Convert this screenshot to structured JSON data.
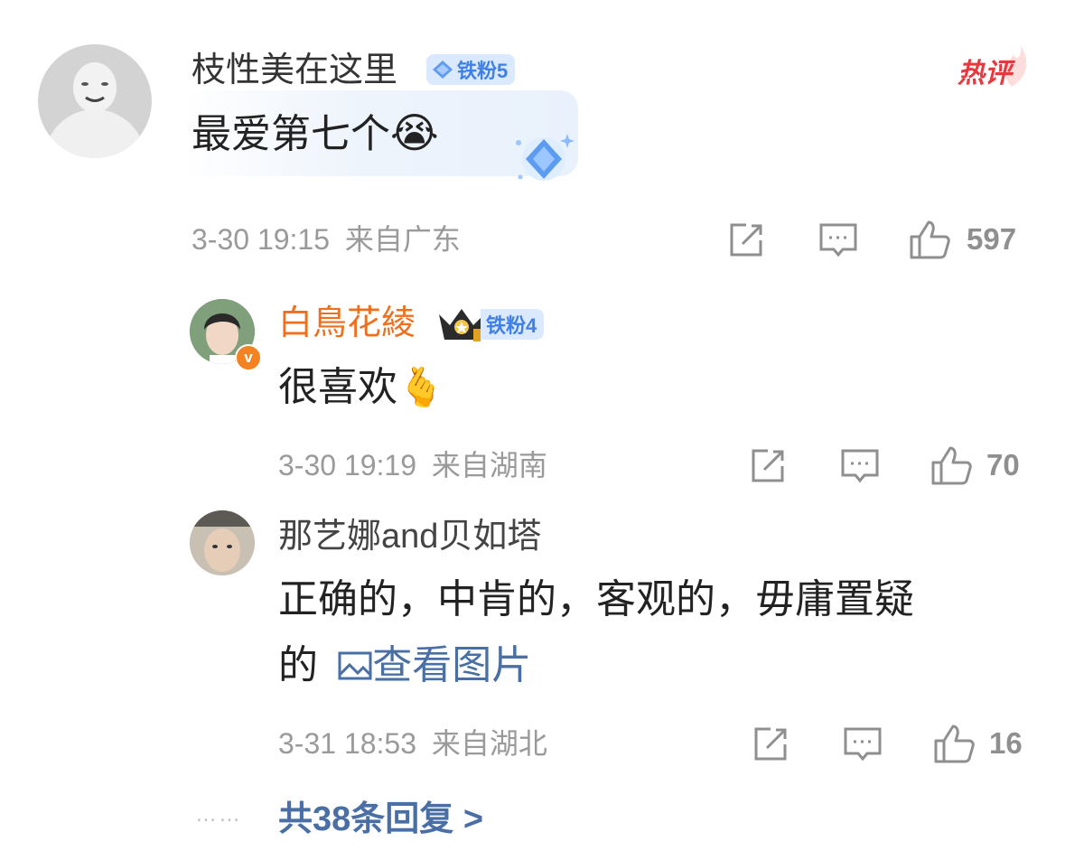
{
  "hot_label": "热评",
  "comment": {
    "user": "枝性美在这里",
    "badge": "铁粉5",
    "text": "最爱第七个",
    "emoji": "😭",
    "time": "3-30 19:15",
    "location": "来自广东",
    "likes": "597"
  },
  "replies": [
    {
      "user": "白鳥花綾",
      "badge": "铁粉4",
      "emoji": "🫰",
      "text": "很喜欢",
      "time": "3-30 19:19",
      "location": "来自湖南",
      "likes": "70",
      "name_color": "#f06f1f",
      "verified": true
    },
    {
      "user": "那艺娜and贝如塔",
      "text_line1": "正确的，中肯的，客观的，毋庸置疑",
      "text_line2": "的",
      "link_text": "查看图片",
      "time": "3-31 18:53",
      "location": "来自湖北",
      "likes": "16"
    }
  ],
  "more_replies": "共38条回复 >",
  "more_dots": "……",
  "icons": {
    "share": "share-icon",
    "comment": "comment-icon",
    "like": "thumb-up-icon",
    "image": "image-icon",
    "verified": "verified-v-icon",
    "crown": "crown-icon",
    "diamond": "diamond-icon"
  },
  "colors": {
    "accent_orange": "#f06f1f",
    "link_blue": "#4a6fa5",
    "hot_red": "#e8383d",
    "badge_blue": "#3f7fe6",
    "meta_gray": "#9a9a9a"
  }
}
